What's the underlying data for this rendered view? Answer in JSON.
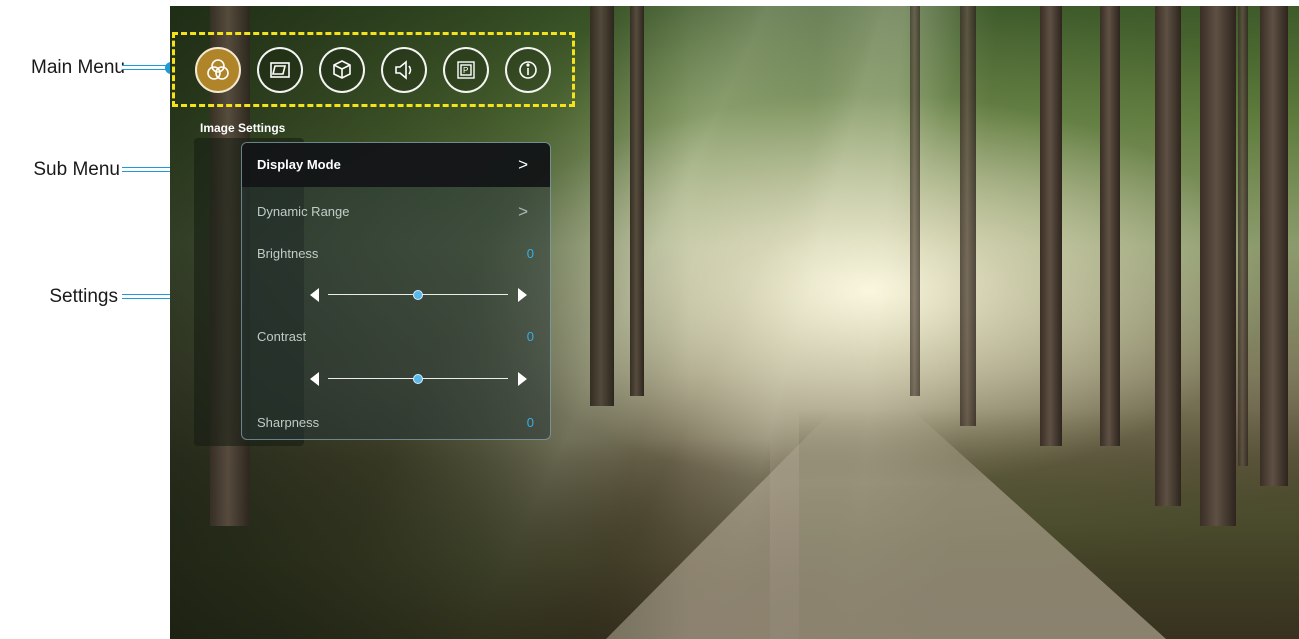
{
  "callouts": {
    "main_menu": "Main Menu",
    "sub_menu": "Sub Menu",
    "settings": "Settings"
  },
  "main_menu": {
    "items": [
      {
        "icon": "color-circles-icon",
        "active": true
      },
      {
        "icon": "display-screen-icon",
        "active": false
      },
      {
        "icon": "3d-cube-icon",
        "active": false
      },
      {
        "icon": "speaker-icon",
        "active": false
      },
      {
        "icon": "setup-grid-icon",
        "active": false
      },
      {
        "icon": "info-icon",
        "active": false
      }
    ]
  },
  "settings_panel": {
    "title": "Image Settings",
    "rows": {
      "display_mode": {
        "label": "Display Mode",
        "arrow": ">"
      },
      "dynamic_range": {
        "label": "Dynamic Range",
        "arrow": ">"
      },
      "brightness": {
        "label": "Brightness",
        "value": "0",
        "slider_level": 0.5
      },
      "contrast": {
        "label": "Contrast",
        "value": "0",
        "slider_level": 0.5
      },
      "sharpness": {
        "label": "Sharpness",
        "value": "0"
      }
    }
  },
  "colors": {
    "callout_blue": "#1e9ad6",
    "highlight_yellow": "#f4e21a",
    "active_icon_gold": "#b0852a",
    "value_blue": "#38aee6"
  }
}
